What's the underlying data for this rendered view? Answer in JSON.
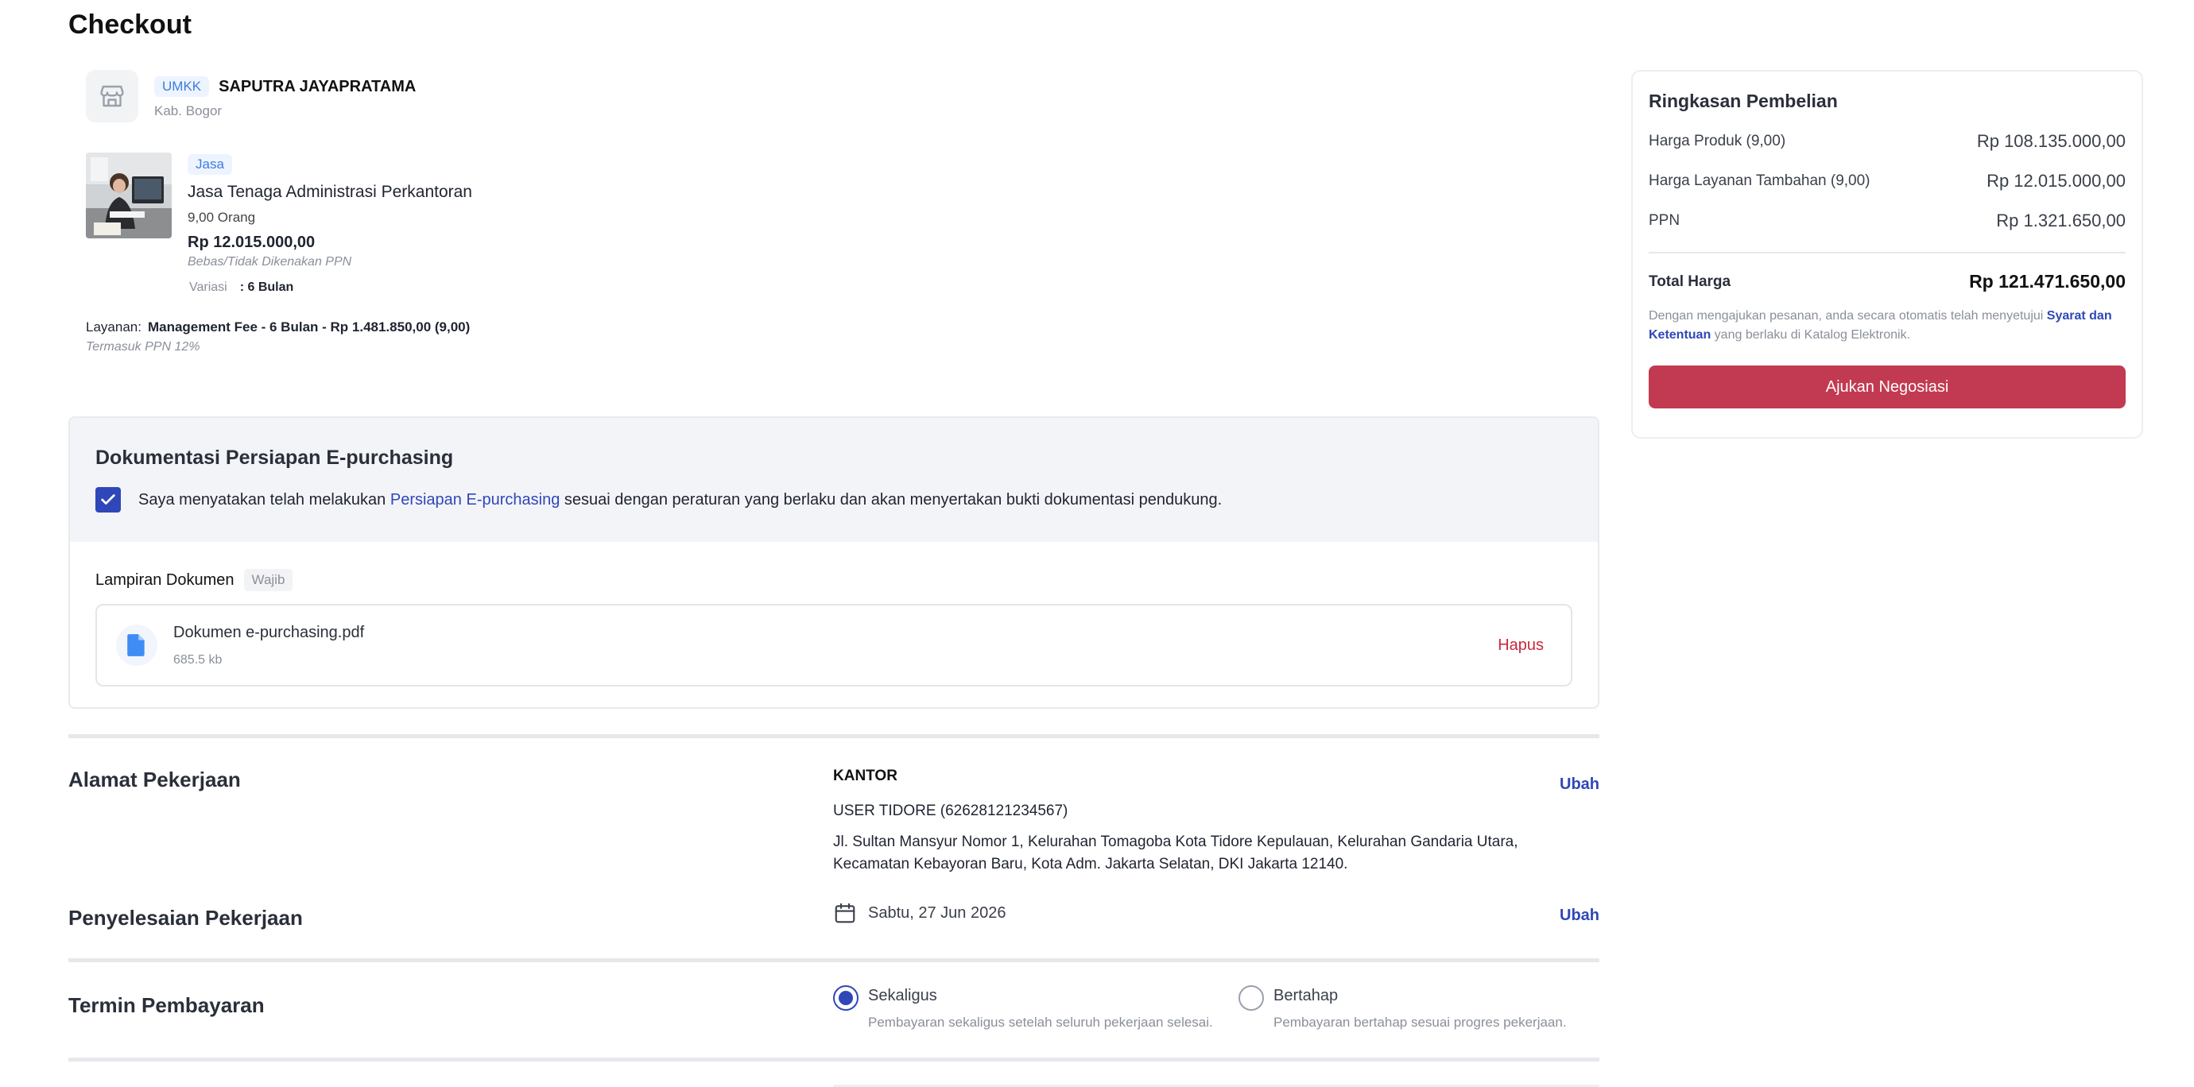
{
  "page": {
    "title": "Checkout"
  },
  "seller": {
    "badge": "UMKK",
    "name": "SAPUTRA JAYAPRATAMA",
    "location": "Kab. Bogor"
  },
  "product": {
    "badge": "Jasa",
    "name": "Jasa Tenaga Administrasi Perkantoran",
    "qty": "9,00 Orang",
    "price": "Rp 12.015.000,00",
    "tax_note": "Bebas/Tidak Dikenakan PPN",
    "variasi_label": "Variasi",
    "variasi_value": ": 6 Bulan"
  },
  "layanan": {
    "label": "Layanan",
    "value": "Management Fee - 6 Bulan - Rp 1.481.850,00 (9,00)",
    "ppn_note": "Termasuk PPN 12%"
  },
  "dokumentasi": {
    "title": "Dokumentasi Persiapan E-purchasing",
    "checked": true,
    "text_before": "Saya menyatakan telah melakukan ",
    "link": "Persiapan E-purchasing",
    "text_after": " sesuai dengan peraturan yang berlaku dan akan menyertakan bukti dokumentasi pendukung.",
    "attach_label": "Lampiran Dokumen",
    "required_badge": "Wajib",
    "file_name": "Dokumen e-purchasing.pdf",
    "file_size": "685.5 kb",
    "delete_label": "Hapus"
  },
  "alamat": {
    "title": "Alamat Pekerjaan",
    "label": "KANTOR",
    "user": "USER TIDORE (62628121234567)",
    "street": "Jl. Sultan Mansyur Nomor 1, Kelurahan Tomagoba Kota Tidore Kepulauan, Kelurahan Gandaria Utara, Kecamatan Kebayoran Baru, Kota Adm. Jakarta Selatan, DKI Jakarta 12140.",
    "edit_label": "Ubah"
  },
  "penyelesaian": {
    "title": "Penyelesaian Pekerjaan",
    "date": "Sabtu, 27 Jun 2026",
    "edit_label": "Ubah"
  },
  "termin": {
    "title": "Termin Pembayaran",
    "options": [
      {
        "label": "Sekaligus",
        "desc": "Pembayaran sekaligus setelah seluruh pekerjaan selesai.",
        "selected": true
      },
      {
        "label": "Bertahap",
        "desc": "Pembayaran bertahap sesuai progres pekerjaan.",
        "selected": false
      }
    ]
  },
  "summary": {
    "title": "Ringkasan Pembelian",
    "rows": [
      {
        "label": "Harga Produk (9,00)",
        "value": "Rp 108.135.000,00"
      },
      {
        "label": "Harga Layanan Tambahan (9,00)",
        "value": "Rp 12.015.000,00"
      },
      {
        "label": "PPN",
        "value": "Rp 1.321.650,00"
      }
    ],
    "total_label": "Total Harga",
    "total_value": "Rp 121.471.650,00",
    "note_before": "Dengan mengajukan pesanan, anda secara otomatis telah menyetujui ",
    "note_link": "Syarat dan Ketentuan",
    "note_after": " yang berlaku di Katalog Elektronik.",
    "button": "Ajukan Negosiasi"
  },
  "colors": {
    "primary": "#2f47b8",
    "danger": "#c8283c",
    "cta": "#c23a51",
    "badge_blue": "#3d7be0"
  },
  "icons": {
    "store": "store-icon",
    "file": "file-icon",
    "calendar": "calendar-icon",
    "check": "check-icon"
  }
}
